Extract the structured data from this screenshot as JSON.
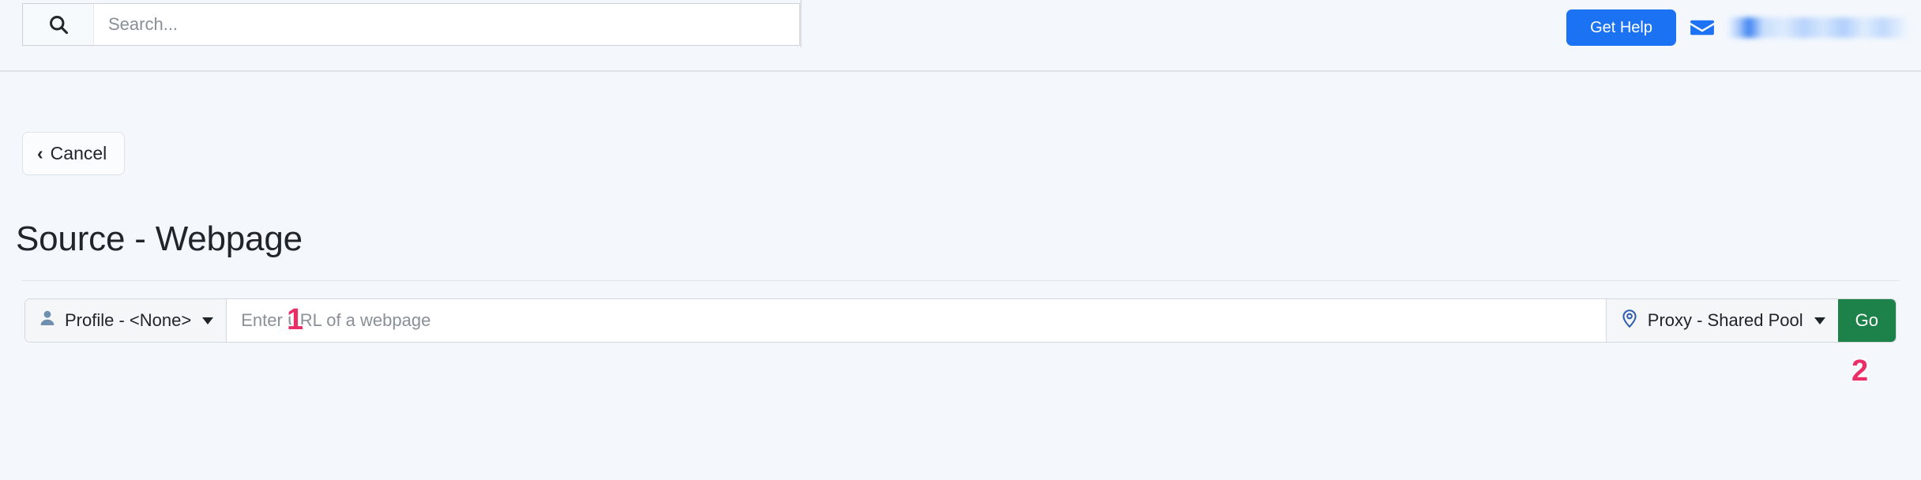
{
  "header": {
    "search": {
      "icon": "search-icon",
      "placeholder": "Search...",
      "value": ""
    },
    "get_help_label": "Get Help",
    "mail_icon": "envelope-icon",
    "account_redacted": ""
  },
  "nav": {
    "cancel_label": "Cancel",
    "cancel_chevron": "‹"
  },
  "main": {
    "title": "Source - Webpage",
    "profile_dropdown": {
      "icon": "person-icon",
      "label": "Profile - <None>"
    },
    "url_input": {
      "placeholder": "Enter URL of a webpage",
      "value": ""
    },
    "proxy_dropdown": {
      "icon": "map-pin-icon",
      "label": "Proxy - Shared Pool"
    },
    "go_label": "Go"
  },
  "annotations": {
    "marker_one": "1",
    "marker_two": "2"
  },
  "colors": {
    "page_background": "#f4f8fd",
    "primary_blue": "#1b72f2",
    "go_green": "#1d8249",
    "marker_pink": "#ea2f68",
    "title_text": "#20252b"
  }
}
